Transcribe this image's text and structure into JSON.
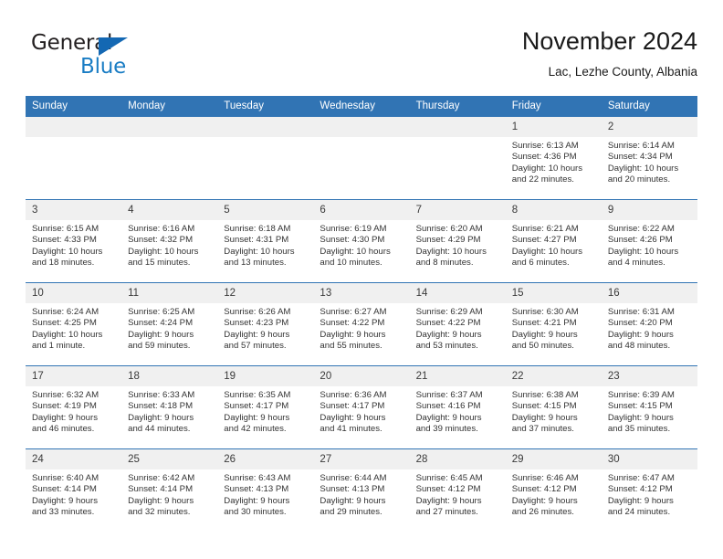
{
  "brand": {
    "name_part1": "General",
    "name_part2": "Blue",
    "accent_color": "#1a7dc4",
    "triangle_color": "#1468b3"
  },
  "header": {
    "title": "November 2024",
    "subtitle": "Lac, Lezhe County, Albania"
  },
  "calendar": {
    "header_bg": "#3174b4",
    "daynum_bg": "#f0f0f0",
    "weekday_headers": [
      "Sunday",
      "Monday",
      "Tuesday",
      "Wednesday",
      "Thursday",
      "Friday",
      "Saturday"
    ],
    "weeks": [
      [
        {
          "day": "",
          "sunrise": "",
          "sunset": "",
          "daylight1": "",
          "daylight2": ""
        },
        {
          "day": "",
          "sunrise": "",
          "sunset": "",
          "daylight1": "",
          "daylight2": ""
        },
        {
          "day": "",
          "sunrise": "",
          "sunset": "",
          "daylight1": "",
          "daylight2": ""
        },
        {
          "day": "",
          "sunrise": "",
          "sunset": "",
          "daylight1": "",
          "daylight2": ""
        },
        {
          "day": "",
          "sunrise": "",
          "sunset": "",
          "daylight1": "",
          "daylight2": ""
        },
        {
          "day": "1",
          "sunrise": "Sunrise: 6:13 AM",
          "sunset": "Sunset: 4:36 PM",
          "daylight1": "Daylight: 10 hours",
          "daylight2": "and 22 minutes."
        },
        {
          "day": "2",
          "sunrise": "Sunrise: 6:14 AM",
          "sunset": "Sunset: 4:34 PM",
          "daylight1": "Daylight: 10 hours",
          "daylight2": "and 20 minutes."
        }
      ],
      [
        {
          "day": "3",
          "sunrise": "Sunrise: 6:15 AM",
          "sunset": "Sunset: 4:33 PM",
          "daylight1": "Daylight: 10 hours",
          "daylight2": "and 18 minutes."
        },
        {
          "day": "4",
          "sunrise": "Sunrise: 6:16 AM",
          "sunset": "Sunset: 4:32 PM",
          "daylight1": "Daylight: 10 hours",
          "daylight2": "and 15 minutes."
        },
        {
          "day": "5",
          "sunrise": "Sunrise: 6:18 AM",
          "sunset": "Sunset: 4:31 PM",
          "daylight1": "Daylight: 10 hours",
          "daylight2": "and 13 minutes."
        },
        {
          "day": "6",
          "sunrise": "Sunrise: 6:19 AM",
          "sunset": "Sunset: 4:30 PM",
          "daylight1": "Daylight: 10 hours",
          "daylight2": "and 10 minutes."
        },
        {
          "day": "7",
          "sunrise": "Sunrise: 6:20 AM",
          "sunset": "Sunset: 4:29 PM",
          "daylight1": "Daylight: 10 hours",
          "daylight2": "and 8 minutes."
        },
        {
          "day": "8",
          "sunrise": "Sunrise: 6:21 AM",
          "sunset": "Sunset: 4:27 PM",
          "daylight1": "Daylight: 10 hours",
          "daylight2": "and 6 minutes."
        },
        {
          "day": "9",
          "sunrise": "Sunrise: 6:22 AM",
          "sunset": "Sunset: 4:26 PM",
          "daylight1": "Daylight: 10 hours",
          "daylight2": "and 4 minutes."
        }
      ],
      [
        {
          "day": "10",
          "sunrise": "Sunrise: 6:24 AM",
          "sunset": "Sunset: 4:25 PM",
          "daylight1": "Daylight: 10 hours",
          "daylight2": "and 1 minute."
        },
        {
          "day": "11",
          "sunrise": "Sunrise: 6:25 AM",
          "sunset": "Sunset: 4:24 PM",
          "daylight1": "Daylight: 9 hours",
          "daylight2": "and 59 minutes."
        },
        {
          "day": "12",
          "sunrise": "Sunrise: 6:26 AM",
          "sunset": "Sunset: 4:23 PM",
          "daylight1": "Daylight: 9 hours",
          "daylight2": "and 57 minutes."
        },
        {
          "day": "13",
          "sunrise": "Sunrise: 6:27 AM",
          "sunset": "Sunset: 4:22 PM",
          "daylight1": "Daylight: 9 hours",
          "daylight2": "and 55 minutes."
        },
        {
          "day": "14",
          "sunrise": "Sunrise: 6:29 AM",
          "sunset": "Sunset: 4:22 PM",
          "daylight1": "Daylight: 9 hours",
          "daylight2": "and 53 minutes."
        },
        {
          "day": "15",
          "sunrise": "Sunrise: 6:30 AM",
          "sunset": "Sunset: 4:21 PM",
          "daylight1": "Daylight: 9 hours",
          "daylight2": "and 50 minutes."
        },
        {
          "day": "16",
          "sunrise": "Sunrise: 6:31 AM",
          "sunset": "Sunset: 4:20 PM",
          "daylight1": "Daylight: 9 hours",
          "daylight2": "and 48 minutes."
        }
      ],
      [
        {
          "day": "17",
          "sunrise": "Sunrise: 6:32 AM",
          "sunset": "Sunset: 4:19 PM",
          "daylight1": "Daylight: 9 hours",
          "daylight2": "and 46 minutes."
        },
        {
          "day": "18",
          "sunrise": "Sunrise: 6:33 AM",
          "sunset": "Sunset: 4:18 PM",
          "daylight1": "Daylight: 9 hours",
          "daylight2": "and 44 minutes."
        },
        {
          "day": "19",
          "sunrise": "Sunrise: 6:35 AM",
          "sunset": "Sunset: 4:17 PM",
          "daylight1": "Daylight: 9 hours",
          "daylight2": "and 42 minutes."
        },
        {
          "day": "20",
          "sunrise": "Sunrise: 6:36 AM",
          "sunset": "Sunset: 4:17 PM",
          "daylight1": "Daylight: 9 hours",
          "daylight2": "and 41 minutes."
        },
        {
          "day": "21",
          "sunrise": "Sunrise: 6:37 AM",
          "sunset": "Sunset: 4:16 PM",
          "daylight1": "Daylight: 9 hours",
          "daylight2": "and 39 minutes."
        },
        {
          "day": "22",
          "sunrise": "Sunrise: 6:38 AM",
          "sunset": "Sunset: 4:15 PM",
          "daylight1": "Daylight: 9 hours",
          "daylight2": "and 37 minutes."
        },
        {
          "day": "23",
          "sunrise": "Sunrise: 6:39 AM",
          "sunset": "Sunset: 4:15 PM",
          "daylight1": "Daylight: 9 hours",
          "daylight2": "and 35 minutes."
        }
      ],
      [
        {
          "day": "24",
          "sunrise": "Sunrise: 6:40 AM",
          "sunset": "Sunset: 4:14 PM",
          "daylight1": "Daylight: 9 hours",
          "daylight2": "and 33 minutes."
        },
        {
          "day": "25",
          "sunrise": "Sunrise: 6:42 AM",
          "sunset": "Sunset: 4:14 PM",
          "daylight1": "Daylight: 9 hours",
          "daylight2": "and 32 minutes."
        },
        {
          "day": "26",
          "sunrise": "Sunrise: 6:43 AM",
          "sunset": "Sunset: 4:13 PM",
          "daylight1": "Daylight: 9 hours",
          "daylight2": "and 30 minutes."
        },
        {
          "day": "27",
          "sunrise": "Sunrise: 6:44 AM",
          "sunset": "Sunset: 4:13 PM",
          "daylight1": "Daylight: 9 hours",
          "daylight2": "and 29 minutes."
        },
        {
          "day": "28",
          "sunrise": "Sunrise: 6:45 AM",
          "sunset": "Sunset: 4:12 PM",
          "daylight1": "Daylight: 9 hours",
          "daylight2": "and 27 minutes."
        },
        {
          "day": "29",
          "sunrise": "Sunrise: 6:46 AM",
          "sunset": "Sunset: 4:12 PM",
          "daylight1": "Daylight: 9 hours",
          "daylight2": "and 26 minutes."
        },
        {
          "day": "30",
          "sunrise": "Sunrise: 6:47 AM",
          "sunset": "Sunset: 4:12 PM",
          "daylight1": "Daylight: 9 hours",
          "daylight2": "and 24 minutes."
        }
      ]
    ]
  }
}
